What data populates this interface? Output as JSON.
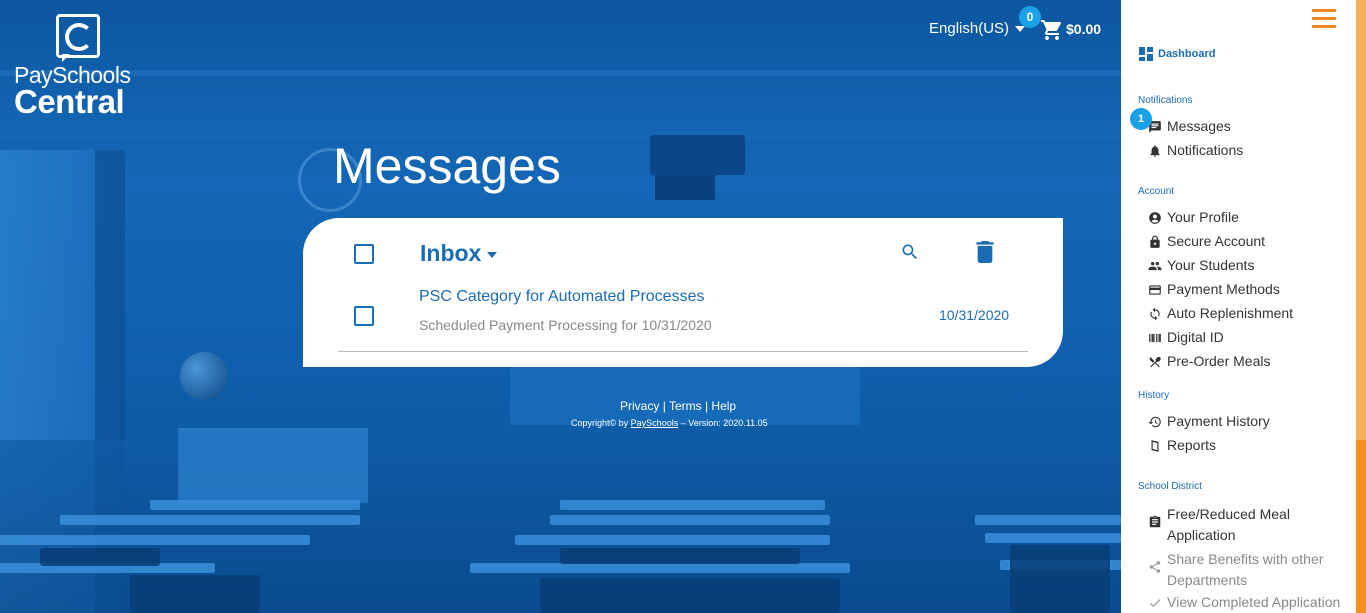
{
  "header": {
    "logo_line1": "PaySchools",
    "logo_line2": "Central",
    "language": "English(US)",
    "cart_count": "0",
    "cart_total": "$0.00"
  },
  "page": {
    "title": "Messages"
  },
  "inbox": {
    "folder_label": "Inbox",
    "messages": [
      {
        "subject": "PSC Category for Automated Processes",
        "preview": "Scheduled Payment Processing for 10/31/2020",
        "date": "10/31/2020"
      }
    ]
  },
  "footer": {
    "privacy": "Privacy",
    "sep1": "|",
    "terms": "Terms",
    "sep2": "|",
    "help": "Help",
    "copyright_prefix": "Copyright© by",
    "copyright_link": "PaySchools",
    "copyright_suffix": "– Version: 2020.11.05"
  },
  "sidebar": {
    "dashboard": "Dashboard",
    "sections": {
      "notifications": "Notifications",
      "account": "Account",
      "history": "History",
      "school_district": "School District"
    },
    "messages_badge": "1",
    "items": {
      "messages": "Messages",
      "notifications": "Notifications",
      "your_profile": "Your Profile",
      "secure_account": "Secure Account",
      "your_students": "Your Students",
      "payment_methods": "Payment Methods",
      "auto_replenishment": "Auto Replenishment",
      "digital_id": "Digital ID",
      "pre_order_meals": "Pre-Order Meals",
      "payment_history": "Payment History",
      "reports": "Reports",
      "free_reduced_1": "Free/Reduced Meal",
      "free_reduced_2": "Application",
      "share_benefits_1": "Share Benefits with other",
      "share_benefits_2": "Departments",
      "view_completed": "View Completed Application"
    }
  },
  "colors": {
    "primary_blue": "#1a6cb3",
    "badge_blue": "#1ba1e6",
    "accent_orange": "#ee8a24"
  }
}
